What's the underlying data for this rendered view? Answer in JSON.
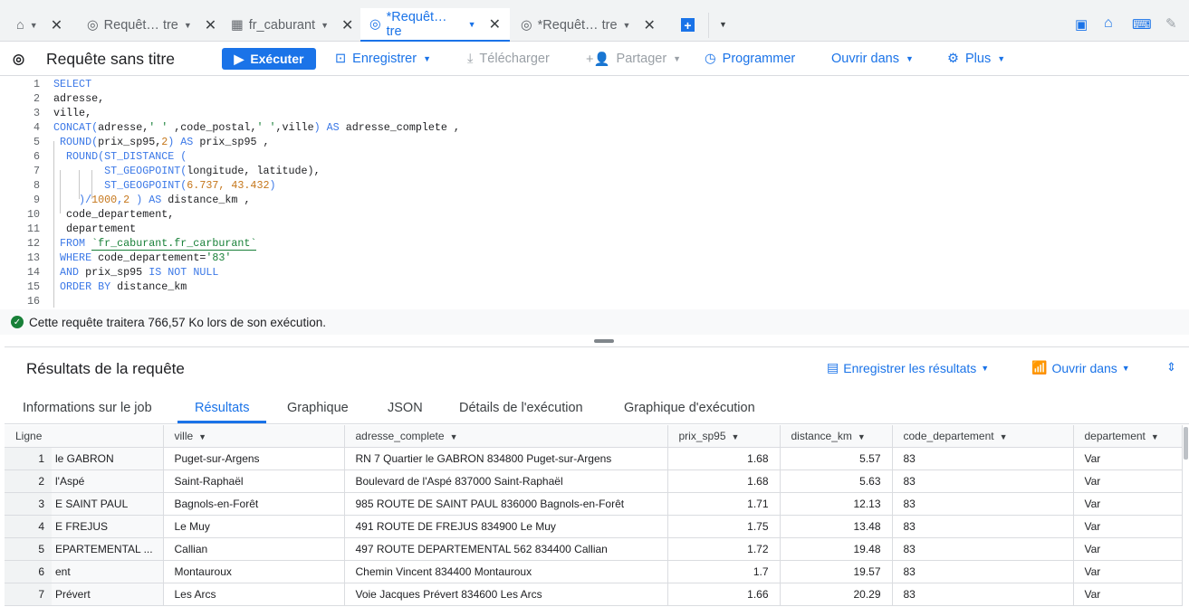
{
  "tabs": [
    {
      "label": "",
      "icon": "home-icon"
    },
    {
      "label": "Requêt…  tre",
      "icon": "query-icon"
    },
    {
      "label": "fr_caburant",
      "icon": "dataset-icon"
    },
    {
      "label": "*Requêt…  tre",
      "icon": "query-icon",
      "active": true
    },
    {
      "label": "*Requêt…  tre",
      "icon": "query-icon"
    }
  ],
  "toolbar": {
    "title": "Requête sans titre",
    "run": "Exécuter",
    "save": "Enregistrer",
    "download": "Télécharger",
    "share": "Partager",
    "schedule": "Programmer",
    "open_in": "Ouvrir dans",
    "more": "Plus"
  },
  "code": [
    [
      [
        "SELECT",
        "kw"
      ]
    ],
    [
      [
        "adresse,",
        ""
      ]
    ],
    [
      [
        "ville,",
        ""
      ]
    ],
    [
      [
        "CONCAT(",
        "kw"
      ],
      [
        "adresse,",
        ""
      ],
      [
        "' ' ",
        "str"
      ],
      [
        ",code_postal,",
        ""
      ],
      [
        "' '",
        "str"
      ],
      [
        ",ville",
        ""
      ],
      [
        ") AS ",
        "kw"
      ],
      [
        "adresse_complete ,",
        ""
      ]
    ],
    [
      [
        " ROUND(",
        "kw"
      ],
      [
        "prix_sp95,",
        ""
      ],
      [
        "2",
        "num"
      ],
      [
        ") AS ",
        "kw"
      ],
      [
        "prix_sp95 ,",
        ""
      ]
    ],
    [
      [
        "  ROUND(ST_DISTANCE (",
        "kw"
      ]
    ],
    [
      [
        "        ST_GEOGPOINT(",
        "kw"
      ],
      [
        "longitude, latitude),",
        ""
      ]
    ],
    [
      [
        "        ST_GEOGPOINT(",
        "kw"
      ],
      [
        "6.737, 43.432",
        "num"
      ],
      [
        ")",
        "kw"
      ]
    ],
    [
      [
        "    )/",
        "kw"
      ],
      [
        "1000",
        "num"
      ],
      [
        ",",
        "kw"
      ],
      [
        "2",
        "num"
      ],
      [
        " ) AS ",
        "kw"
      ],
      [
        "distance_km ,",
        ""
      ]
    ],
    [
      [
        "  code_departement,",
        ""
      ]
    ],
    [
      [
        "  departement",
        ""
      ]
    ],
    [
      [
        " FROM ",
        "kw"
      ],
      [
        "`fr_caburant.fr_carburant`",
        "tbl"
      ]
    ],
    [
      [
        " WHERE ",
        "kw"
      ],
      [
        "code_departement=",
        ""
      ],
      [
        "'83'",
        "str"
      ]
    ],
    [
      [
        " AND ",
        "kw"
      ],
      [
        "prix_sp95 ",
        ""
      ],
      [
        "IS NOT NULL",
        "kw"
      ]
    ],
    [
      [
        " ORDER BY ",
        "kw"
      ],
      [
        "distance_km",
        ""
      ]
    ],
    [
      [
        "",
        ""
      ]
    ]
  ],
  "status": "Cette requête traitera 766,57 Ko lors de son exécution.",
  "results": {
    "title": "Résultats de la requête",
    "save_results": "Enregistrer les résultats",
    "open_in": "Ouvrir dans",
    "tabs": [
      "Informations sur le job",
      "Résultats",
      "Graphique",
      "JSON",
      "Détails de l'exécution",
      "Graphique d'exécution"
    ],
    "columns": [
      "Ligne",
      "ville",
      "adresse_complete",
      "prix_sp95",
      "distance_km",
      "code_departement",
      "departement"
    ],
    "rows": [
      [
        "1",
        "le GABRON",
        "Puget-sur-Argens",
        "RN 7 Quartier le GABRON 834800 Puget-sur-Argens",
        "1.68",
        "5.57",
        "83",
        "Var"
      ],
      [
        "2",
        "l'Aspé",
        "Saint-Raphaël",
        "Boulevard de l'Aspé 837000 Saint-Raphaël",
        "1.68",
        "5.63",
        "83",
        "Var"
      ],
      [
        "3",
        "E SAINT PAUL",
        "Bagnols-en-Forêt",
        "985 ROUTE DE SAINT PAUL 836000 Bagnols-en-Forêt",
        "1.71",
        "12.13",
        "83",
        "Var"
      ],
      [
        "4",
        "E FREJUS",
        "Le Muy",
        "491 ROUTE DE FREJUS 834900 Le Muy",
        "1.75",
        "13.48",
        "83",
        "Var"
      ],
      [
        "5",
        "EPARTEMENTAL ...",
        "Callian",
        "497 ROUTE DEPARTEMENTAL 562 834400 Callian",
        "1.72",
        "19.48",
        "83",
        "Var"
      ],
      [
        "6",
        "ent",
        "Montauroux",
        "Chemin Vincent 834400 Montauroux",
        "1.7",
        "19.57",
        "83",
        "Var"
      ],
      [
        "7",
        "Prévert",
        "Les Arcs",
        "Voie Jacques Prévert 834600 Les Arcs",
        "1.66",
        "20.29",
        "83",
        "Var"
      ]
    ]
  },
  "colors": {
    "accent": "#1a73e8",
    "success": "#188038"
  }
}
